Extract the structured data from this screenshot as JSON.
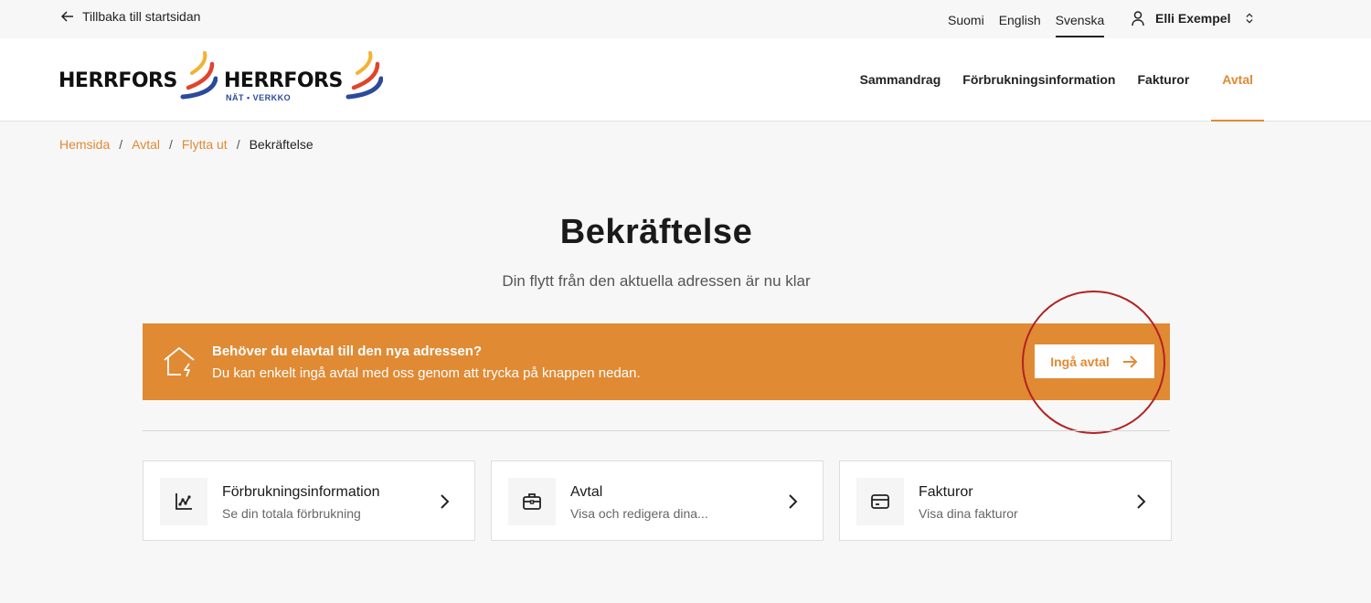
{
  "topbar": {
    "back_label": "Tillbaka till startsidan",
    "languages": [
      "Suomi",
      "English",
      "Svenska"
    ],
    "active_language": "Svenska",
    "user_name": "Elli Exempel"
  },
  "header": {
    "logo1": {
      "word": "HERRFORS"
    },
    "logo2": {
      "word": "HERRFORS",
      "sub": "NÄT • VERKKO"
    },
    "nav": [
      "Sammandrag",
      "Förbrukningsinformation",
      "Fakturor",
      "Avtal"
    ],
    "active_nav": "Avtal"
  },
  "breadcrumb": {
    "links": [
      "Hemsida",
      "Avtal",
      "Flytta ut"
    ],
    "current": "Bekräftelse",
    "separator": "/"
  },
  "main": {
    "title": "Bekräftelse",
    "subtitle": "Din flytt från den aktuella adressen är nu klar"
  },
  "banner": {
    "title": "Behöver du elavtal till den nya adressen?",
    "text": "Du kan enkelt ingå avtal med oss genom att trycka på knappen nedan.",
    "button_label": "Ingå avtal",
    "color": "#e08a34"
  },
  "cards": [
    {
      "title": "Förbrukningsinformation",
      "subtitle": "Se din totala förbrukning",
      "icon": "chart-icon"
    },
    {
      "title": "Avtal",
      "subtitle": "Visa och redigera dina...",
      "icon": "briefcase-icon"
    },
    {
      "title": "Fakturor",
      "subtitle": "Visa dina fakturor",
      "icon": "credit-card-icon"
    }
  ],
  "colors": {
    "accent": "#e08a34",
    "annotation_circle": "#b22222",
    "logo_blue": "#2b4a9b",
    "logo_red": "#e0452b",
    "logo_yellow": "#f2b233"
  }
}
